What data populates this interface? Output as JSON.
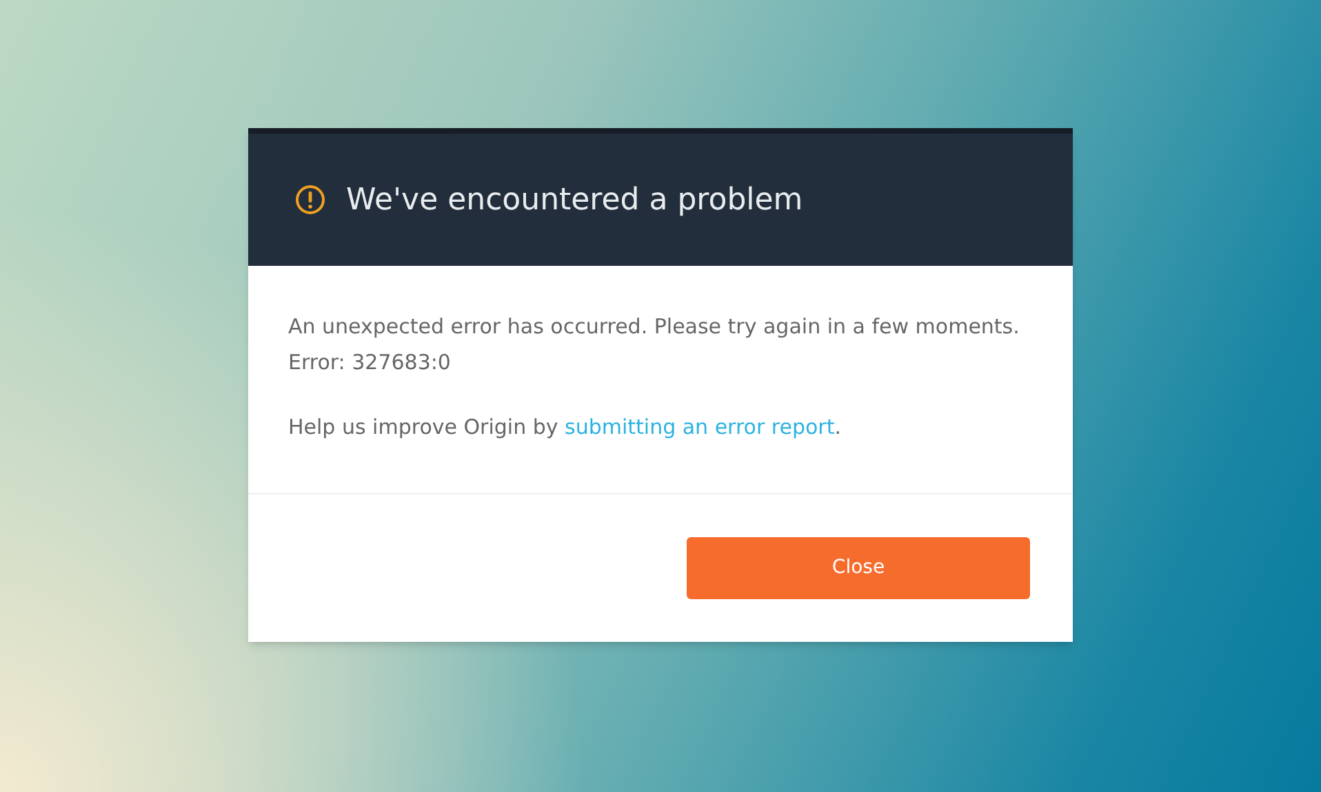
{
  "dialog": {
    "title": "We've encountered a problem",
    "message": "An unexpected error has occurred. Please try again in a few moments.",
    "error_code": "Error: 327683:0",
    "help": {
      "before": "Help us improve Origin by ",
      "link": "submitting an error report",
      "after": "."
    },
    "buttons": [
      "Close"
    ]
  }
}
